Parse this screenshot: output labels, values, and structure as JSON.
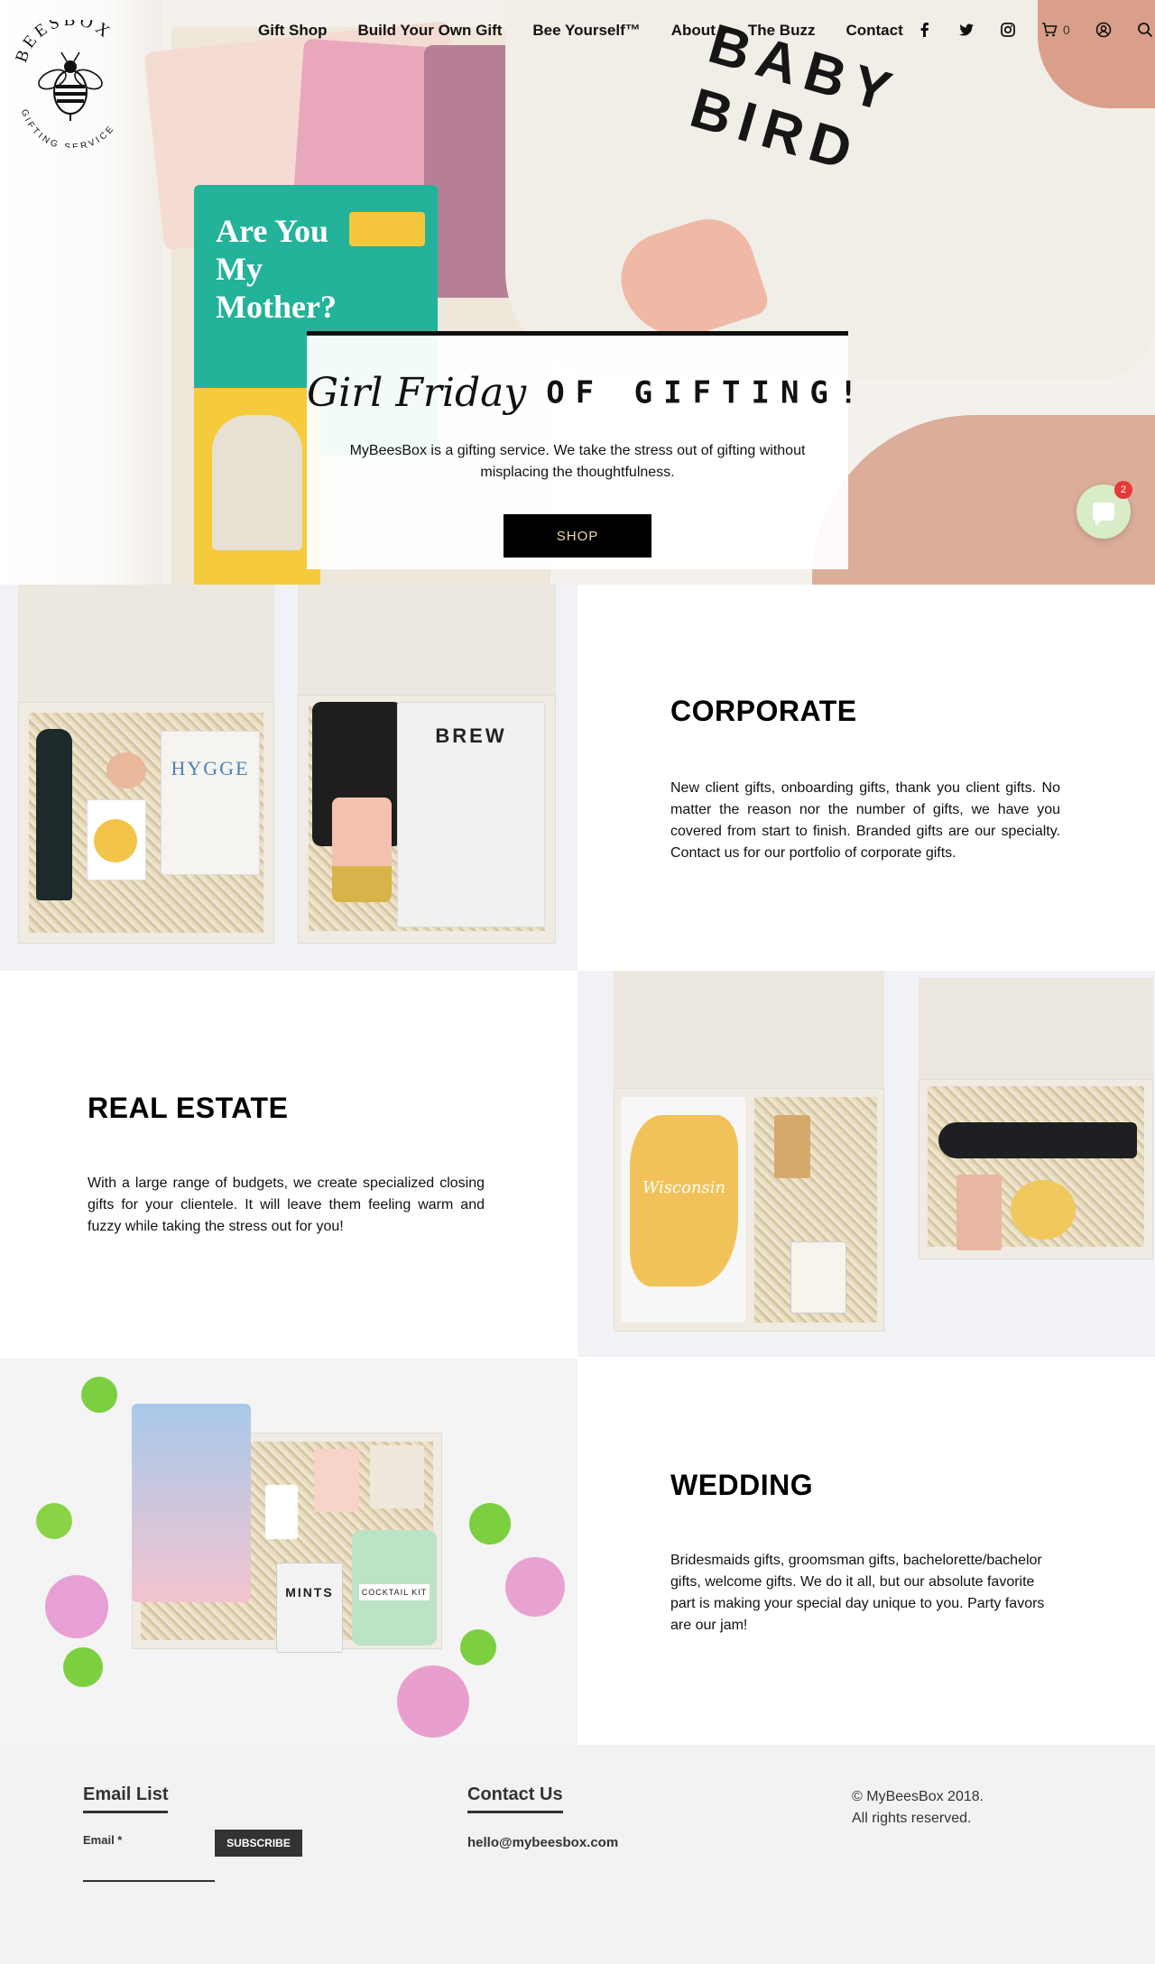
{
  "nav": {
    "items": [
      {
        "label": "Gift Shop"
      },
      {
        "label": "Build Your Own Gift"
      },
      {
        "label": "Bee Yourself™"
      },
      {
        "label": "About"
      },
      {
        "label": "The Buzz"
      },
      {
        "label": "Contact"
      }
    ],
    "cart_count": "0",
    "icons": [
      "facebook-icon",
      "twitter-icon",
      "instagram-icon",
      "cart-icon",
      "account-icon",
      "search-icon"
    ]
  },
  "logo": {
    "top_text": "BEESBOX",
    "bottom_text": "GIFTING SERVICE"
  },
  "hero": {
    "script_text": "Girl Friday",
    "caps_text": "OF GIFTING!",
    "description": "MyBeesBox is a gifting service. We take the stress out of gifting without misplacing the thoughtfulness.",
    "button_label": "SHOP",
    "book_title": "Are You My Mother?",
    "onesie_text": "BABY BIRD"
  },
  "chat": {
    "badge_count": "2"
  },
  "sections": [
    {
      "title": "CORPORATE",
      "body": "New client gifts, onboarding gifts, thank you client gifts. No matter the reason nor the number of gifts, we have you covered from start to finish. Branded gifts are our specialty. Contact us for our portfolio of corporate gifts."
    },
    {
      "title": "REAL ESTATE",
      "body": "With a large range of budgets, we create specialized closing gifts for your clientele. It will leave them feeling warm and fuzzy while taking the stress out for you!"
    },
    {
      "title": "WEDDING",
      "body": "Bridesmaids gifts, groomsman gifts, bachelorette/bachelor gifts, welcome gifts. We do it all, but our absolute favorite part is making your special day unique to you. Party favors are our jam!"
    }
  ],
  "product_labels": {
    "hygge": "HYGGE",
    "brew": "BREW",
    "mints": "MINTS",
    "cocktail": "COCKTAIL KIT",
    "wisconsin": "Wisconsin"
  },
  "footer": {
    "email_heading": "Email List",
    "email_label": "Email *",
    "subscribe_label": "SUBSCRIBE",
    "contact_heading": "Contact Us",
    "contact_email": "hello@mybeesbox.com",
    "copyright_line1": "© MyBeesBox 2018.",
    "copyright_line2": "All rights reserved."
  },
  "colors": {
    "button_bg": "#000000",
    "button_text": "#f1d9a6",
    "chat_bg": "#d8ecc7",
    "badge_red": "#e53935",
    "footer_bg": "#f2f2f2"
  }
}
